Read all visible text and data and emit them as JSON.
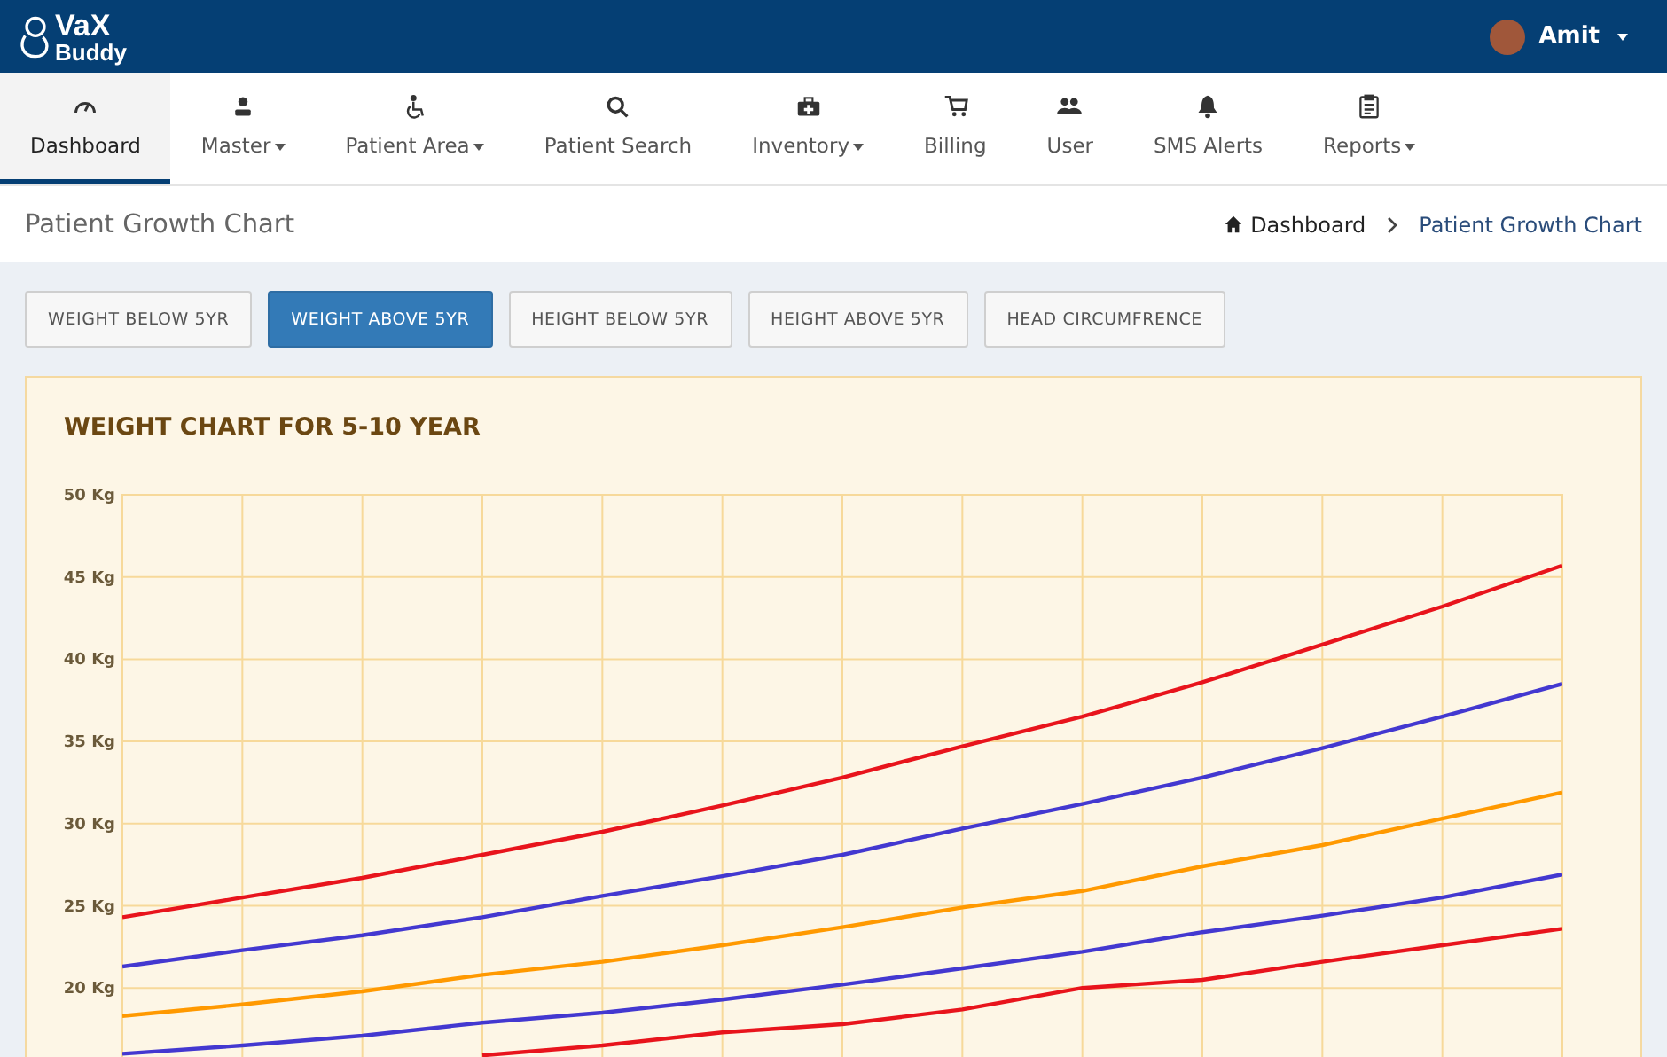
{
  "topbar": {
    "logo": {
      "line1": "VaX",
      "line2": "Buddy"
    },
    "user": {
      "name": "Amit"
    }
  },
  "nav": [
    {
      "label": "Dashboard",
      "dropdown": false,
      "selected": true
    },
    {
      "label": "Master",
      "dropdown": true,
      "selected": false
    },
    {
      "label": "Patient Area",
      "dropdown": true,
      "selected": false
    },
    {
      "label": "Patient Search",
      "dropdown": false,
      "selected": false
    },
    {
      "label": "Inventory",
      "dropdown": true,
      "selected": false
    },
    {
      "label": "Billing",
      "dropdown": false,
      "selected": false
    },
    {
      "label": "User",
      "dropdown": false,
      "selected": false
    },
    {
      "label": "SMS Alerts",
      "dropdown": false,
      "selected": false
    },
    {
      "label": "Reports",
      "dropdown": true,
      "selected": false
    }
  ],
  "page_header": {
    "title": "Patient Growth Chart",
    "breadcrumb": [
      {
        "label": "Dashboard"
      },
      {
        "label": "Patient Growth Chart"
      }
    ]
  },
  "chart_tabs": [
    {
      "label": "WEIGHT BELOW 5YR",
      "selected": false
    },
    {
      "label": "WEIGHT ABOVE 5YR",
      "selected": true
    },
    {
      "label": "HEIGHT BELOW 5YR",
      "selected": false
    },
    {
      "label": "HEIGHT ABOVE 5YR",
      "selected": false
    },
    {
      "label": "HEAD CIRCUMFRENCE",
      "selected": false
    }
  ],
  "chart_card": {
    "chart_data": {
      "type": "line",
      "grid": true,
      "title": "WEIGHT CHART FOR 5-10 YEAR",
      "ylim": [
        15,
        50
      ],
      "yticks": [
        {
          "value": 20,
          "label": "20 Kg"
        },
        {
          "value": 25,
          "label": "25 Kg"
        },
        {
          "value": 30,
          "label": "30 Kg"
        },
        {
          "value": 35,
          "label": "35 Kg"
        },
        {
          "value": 40,
          "label": "40 Kg"
        },
        {
          "value": 45,
          "label": "45 Kg"
        },
        {
          "value": 50,
          "label": "50 Kg"
        }
      ],
      "series": [
        {
          "color": "#e8141c",
          "values": [
            24.3,
            25.5,
            26.7,
            28.1,
            29.5,
            31.1,
            32.8,
            34.7,
            36.5,
            38.6,
            40.9,
            43.2,
            45.7
          ]
        },
        {
          "color": "#4338d0",
          "values": [
            21.3,
            22.3,
            23.2,
            24.3,
            25.6,
            26.8,
            28.1,
            29.7,
            31.2,
            32.8,
            34.6,
            36.5,
            38.5
          ]
        },
        {
          "color": "#ff9900",
          "values": [
            18.3,
            19.0,
            19.8,
            20.8,
            21.6,
            22.6,
            23.7,
            24.9,
            25.9,
            27.4,
            28.7,
            30.3,
            31.9
          ]
        },
        {
          "color": "#4338d0",
          "values": [
            16.0,
            16.5,
            17.1,
            17.9,
            18.5,
            19.3,
            20.2,
            21.2,
            22.2,
            23.4,
            24.4,
            25.5,
            26.9
          ]
        },
        {
          "color": "#e8141c",
          "values": [
            null,
            null,
            null,
            15.9,
            16.5,
            17.3,
            17.8,
            18.7,
            20.0,
            20.5,
            21.6,
            22.6,
            23.6
          ]
        }
      ]
    }
  }
}
